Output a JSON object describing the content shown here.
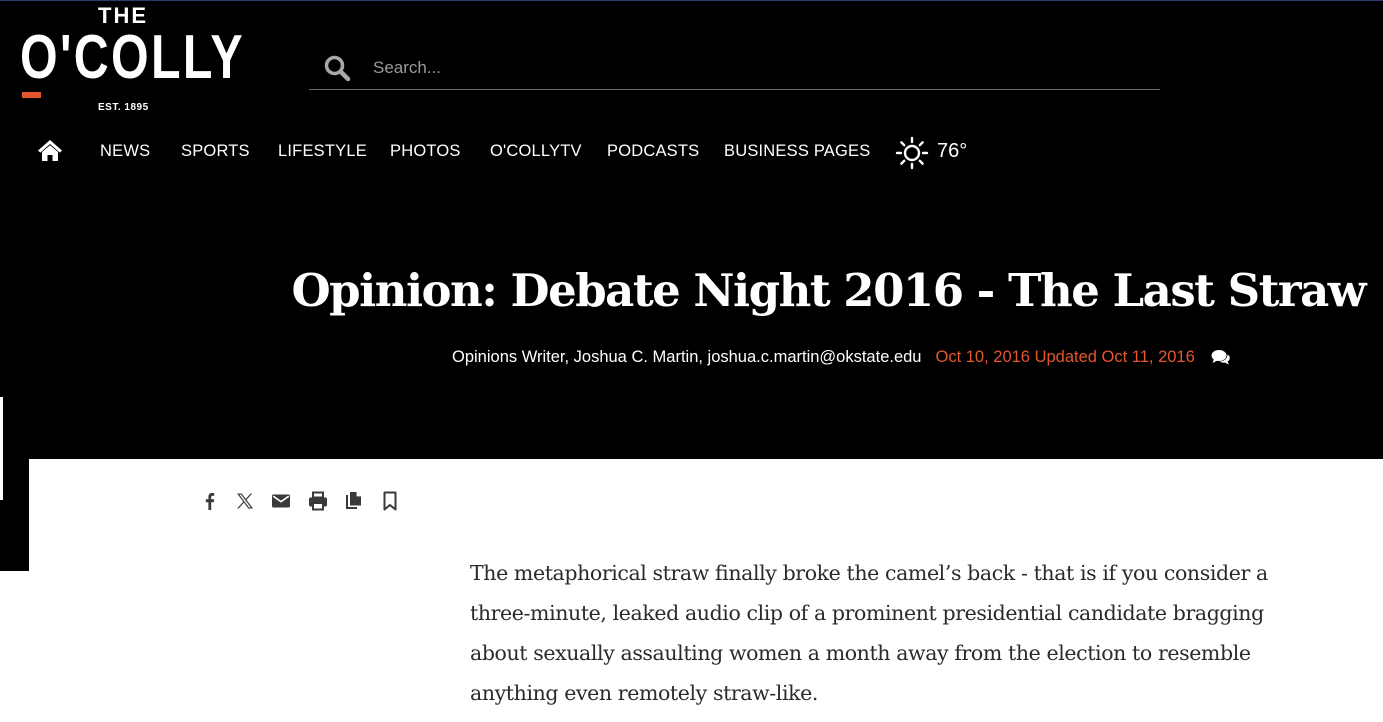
{
  "brand": {
    "the": "THE",
    "name": "O'COLLY",
    "est": "EST. 1895",
    "accent_color": "#e4572e"
  },
  "search": {
    "placeholder": "Search...",
    "icon": "search-icon"
  },
  "nav": {
    "home_icon": "home-icon",
    "items": [
      {
        "label": "NEWS"
      },
      {
        "label": "SPORTS"
      },
      {
        "label": "LIFESTYLE"
      },
      {
        "label": "PHOTOS"
      },
      {
        "label": "O'COLLYTV"
      },
      {
        "label": "PODCASTS"
      },
      {
        "label": "BUSINESS PAGES"
      }
    ],
    "weather": {
      "icon": "sun-icon",
      "temperature": "76°"
    }
  },
  "article": {
    "headline": "Opinion: Debate Night 2016 - The Last Straw",
    "author": "Opinions Writer, Joshua C. Martin, joshua.c.martin@okstate.edu",
    "dates": "Oct 10, 2016 Updated Oct 11, 2016",
    "comment_icon": "comments-icon",
    "body": "The metaphorical straw finally broke the camel’s back - that is if you consider a three-minute, leaked audio clip of a prominent presidential candidate bragging about sexually assaulting women a month away from the election to resemble anything even remotely straw-like."
  },
  "share_tools": [
    {
      "icon": "facebook-icon"
    },
    {
      "icon": "x-twitter-icon"
    },
    {
      "icon": "email-icon"
    },
    {
      "icon": "print-icon"
    },
    {
      "icon": "copy-icon"
    },
    {
      "icon": "bookmark-icon"
    }
  ]
}
